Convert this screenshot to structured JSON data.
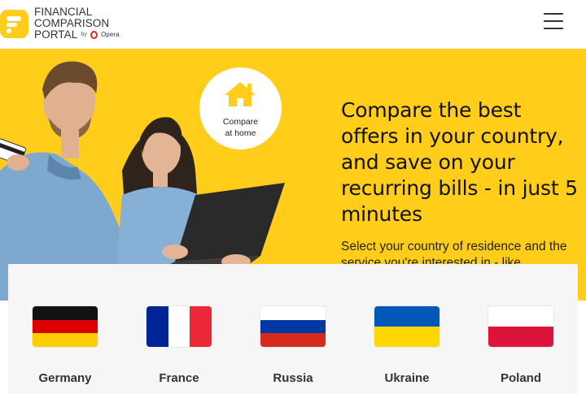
{
  "header": {
    "logo_line1": "FINANCIAL COMPARISON",
    "logo_line2": "PORTAL",
    "logo_by": "by",
    "logo_opera": "Opera",
    "menu_icon": "hamburger-menu-icon"
  },
  "hero": {
    "badge_line1": "Compare",
    "badge_line2": "at home",
    "badge_icon": "home-icon",
    "headline": "Compare the best offers in your country, and save on your recurring bills - in just 5 minutes",
    "subtext": "Select your country of residence and the service you're interested in - like"
  },
  "countries": [
    {
      "name": "Germany",
      "flag": "germany-flag",
      "stripes": [
        "#111111",
        "#dd0000",
        "#ffce00"
      ],
      "dir": "h"
    },
    {
      "name": "France",
      "flag": "france-flag",
      "stripes": [
        "#002395",
        "#ffffff",
        "#ed2939"
      ],
      "dir": "v"
    },
    {
      "name": "Russia",
      "flag": "russia-flag",
      "stripes": [
        "#ffffff",
        "#0039a6",
        "#d52b1e"
      ],
      "dir": "h"
    },
    {
      "name": "Ukraine",
      "flag": "ukraine-flag",
      "stripes": [
        "#0057b7",
        "#ffd700"
      ],
      "dir": "h"
    },
    {
      "name": "Poland",
      "flag": "poland-flag",
      "stripes": [
        "#ffffff",
        "#dc143c"
      ],
      "dir": "h"
    }
  ],
  "colors": {
    "brand_yellow": "#ffcd1a",
    "opera_red": "#e4262b"
  }
}
